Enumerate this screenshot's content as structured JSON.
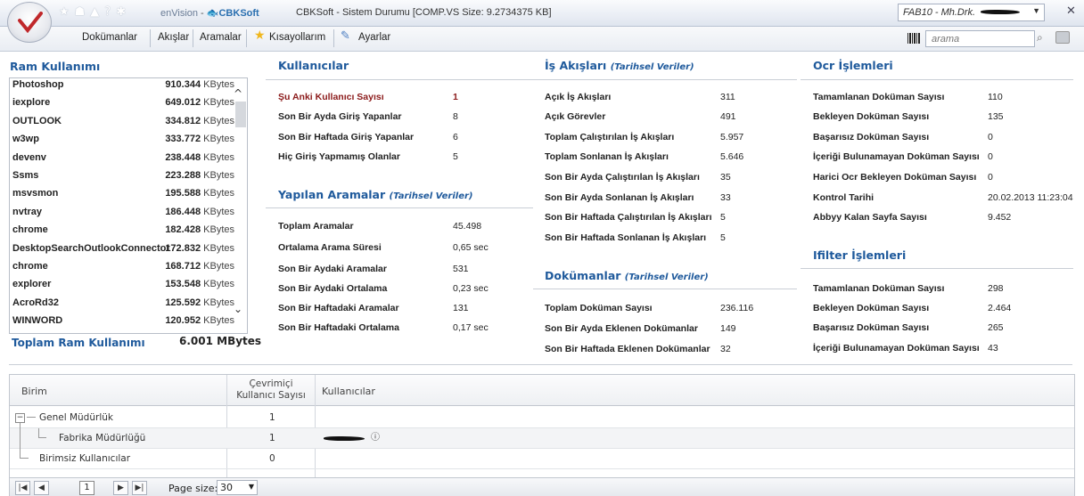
{
  "header": {
    "brand_env": "enVision",
    "brand_cbk": "CBKSoft",
    "window_title": "CBKSoft - Sistem Durumu [COMP.VS Size: 9.2734375 KB]",
    "user_select": "FAB10 - Mh.Drk."
  },
  "menu": {
    "items": [
      "Dokümanlar",
      "Akışlar",
      "Aramalar",
      "Kısayollarım",
      "Ayarlar"
    ],
    "search_placeholder": "arama"
  },
  "ram": {
    "title": "Ram Kullanımı",
    "rows": [
      {
        "name": "Photoshop",
        "value": "910.344",
        "unit": "KBytes"
      },
      {
        "name": "iexplore",
        "value": "649.012",
        "unit": "KBytes"
      },
      {
        "name": "OUTLOOK",
        "value": "334.812",
        "unit": "KBytes"
      },
      {
        "name": "w3wp",
        "value": "333.772",
        "unit": "KBytes"
      },
      {
        "name": "devenv",
        "value": "238.448",
        "unit": "KBytes"
      },
      {
        "name": "Ssms",
        "value": "223.288",
        "unit": "KBytes"
      },
      {
        "name": "msvsmon",
        "value": "195.588",
        "unit": "KBytes"
      },
      {
        "name": "nvtray",
        "value": "186.448",
        "unit": "KBytes"
      },
      {
        "name": "chrome",
        "value": "182.428",
        "unit": "KBytes"
      },
      {
        "name": "DesktopSearchOutlookConnector",
        "value": "172.832",
        "unit": "KBytes"
      },
      {
        "name": "chrome",
        "value": "168.712",
        "unit": "KBytes"
      },
      {
        "name": "explorer",
        "value": "153.548",
        "unit": "KBytes"
      },
      {
        "name": "AcroRd32",
        "value": "125.592",
        "unit": "KBytes"
      },
      {
        "name": "WINWORD",
        "value": "120.952",
        "unit": "KBytes"
      }
    ],
    "total_label": "Toplam Ram Kullanımı",
    "total_value": "6.001 MBytes"
  },
  "users": {
    "title": "Kullanıcılar",
    "rows": [
      {
        "label": "Şu Anki Kullanıcı Sayısı",
        "value": "1"
      },
      {
        "label": "Son Bir Ayda Giriş Yapanlar",
        "value": "8"
      },
      {
        "label": "Son Bir Haftada Giriş Yapanlar",
        "value": "6"
      },
      {
        "label": "Hiç Giriş Yapmamış Olanlar",
        "value": "5"
      }
    ]
  },
  "searches": {
    "title": "Yapılan Aramalar",
    "hist": "(Tarihsel Veriler)",
    "rows": [
      {
        "label": "Toplam Aramalar",
        "value": "45.498"
      },
      {
        "label": "Ortalama Arama Süresi",
        "value": "0,65 sec"
      },
      {
        "label": "Son Bir Aydaki Aramalar",
        "value": "531"
      },
      {
        "label": "Son Bir Aydaki Ortalama",
        "value": "0,23 sec"
      },
      {
        "label": "Son Bir Haftadaki Aramalar",
        "value": "131"
      },
      {
        "label": "Son Bir Haftadaki Ortalama",
        "value": "0,17 sec"
      }
    ]
  },
  "workflows": {
    "title": "İş Akışları",
    "hist": "(Tarihsel Veriler)",
    "rows": [
      {
        "label": "Açık İş Akışları",
        "value": "311"
      },
      {
        "label": "Açık Görevler",
        "value": "491"
      },
      {
        "label": "Toplam Çalıştırılan İş Akışları",
        "value": "5.957"
      },
      {
        "label": "Toplam Sonlanan İş Akışları",
        "value": "5.646"
      },
      {
        "label": "Son Bir Ayda Çalıştırılan İş Akışları",
        "value": "35"
      },
      {
        "label": "Son Bir Ayda Sonlanan İş Akışları",
        "value": "33"
      },
      {
        "label": "Son Bir Haftada Çalıştırılan İş Akışları",
        "value": "5"
      },
      {
        "label": "Son Bir Haftada Sonlanan İş Akışları",
        "value": "5"
      }
    ]
  },
  "documents": {
    "title": "Dokümanlar",
    "hist": "(Tarihsel Veriler)",
    "rows": [
      {
        "label": "Toplam Doküman Sayısı",
        "value": "236.116"
      },
      {
        "label": "Son Bir Ayda Eklenen Dokümanlar",
        "value": "149"
      },
      {
        "label": "Son Bir Haftada Eklenen Dokümanlar",
        "value": "32"
      }
    ]
  },
  "ocr": {
    "title": "Ocr İşlemleri",
    "rows": [
      {
        "label": "Tamamlanan Doküman Sayısı",
        "value": "110"
      },
      {
        "label": "Bekleyen Doküman Sayısı",
        "value": "135"
      },
      {
        "label": "Başarısız Doküman Sayısı",
        "value": "0"
      },
      {
        "label": "İçeriği Bulunamayan Doküman Sayısı",
        "value": "0"
      },
      {
        "label": "Harici Ocr Bekleyen Doküman Sayısı",
        "value": "0"
      },
      {
        "label": "Kontrol Tarihi",
        "value": "20.02.2013 11:23:04"
      },
      {
        "label": "Abbyy Kalan Sayfa Sayısı",
        "value": "9.452"
      }
    ]
  },
  "ifilter": {
    "title": "Ifilter İşlemleri",
    "rows": [
      {
        "label": "Tamamlanan Doküman Sayısı",
        "value": "298"
      },
      {
        "label": "Bekleyen Doküman Sayısı",
        "value": "2.464"
      },
      {
        "label": "Başarısız Doküman Sayısı",
        "value": "265"
      },
      {
        "label": "İçeriği Bulunamayan Doküman Sayısı",
        "value": "43"
      }
    ]
  },
  "grid": {
    "columns": [
      "Birim",
      "Çevrimiçi",
      "Kullanıcı Sayısı",
      "Kullanıcılar"
    ],
    "rows": [
      {
        "name": "Genel Müdürlük",
        "count": "1"
      },
      {
        "name": "Fabrika Müdürlüğü",
        "count": "1"
      },
      {
        "name": "Birimsiz Kullanıcılar",
        "count": "0"
      }
    ],
    "pager": {
      "page": "1",
      "page_size_label": "Page size:",
      "page_size": "30"
    }
  }
}
